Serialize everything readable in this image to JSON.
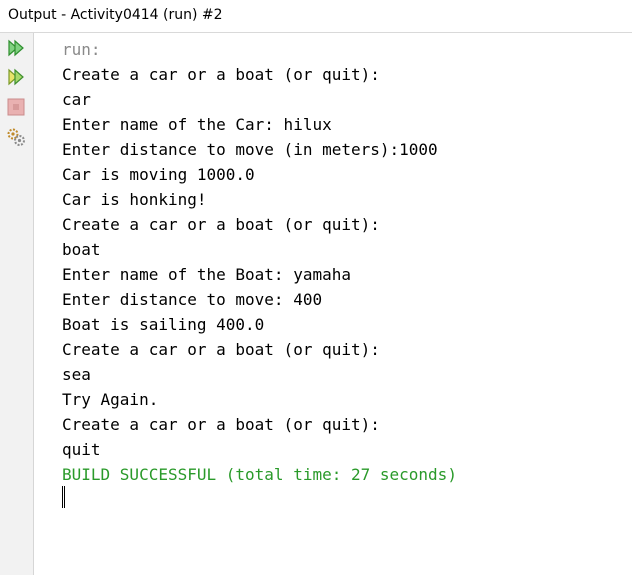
{
  "window": {
    "title": "Output - Activity0414 (run) #2"
  },
  "toolbar": {
    "icons": [
      "rerun-icon",
      "rerun-with-options-icon",
      "stop-icon",
      "settings-icon"
    ]
  },
  "console": {
    "lines": [
      "run:",
      "Create a car or a boat (or quit):",
      "car",
      "Enter name of the Car: hilux",
      "Enter distance to move (in meters):1000",
      "Car is moving 1000.0",
      "Car is honking!",
      "Create a car or a boat (or quit):",
      "boat",
      "Enter name of the Boat: yamaha",
      "Enter distance to move: 400",
      "Boat is sailing 400.0",
      "Create a car or a boat (or quit):",
      "sea",
      "Try Again.",
      "Create a car or a boat (or quit):",
      "quit",
      "BUILD SUCCESSFUL (total time: 27 seconds)"
    ]
  },
  "colors": {
    "info_text": "#8a8a8a",
    "success_text": "#2a9a2a",
    "run_icon": "#33aa33"
  }
}
